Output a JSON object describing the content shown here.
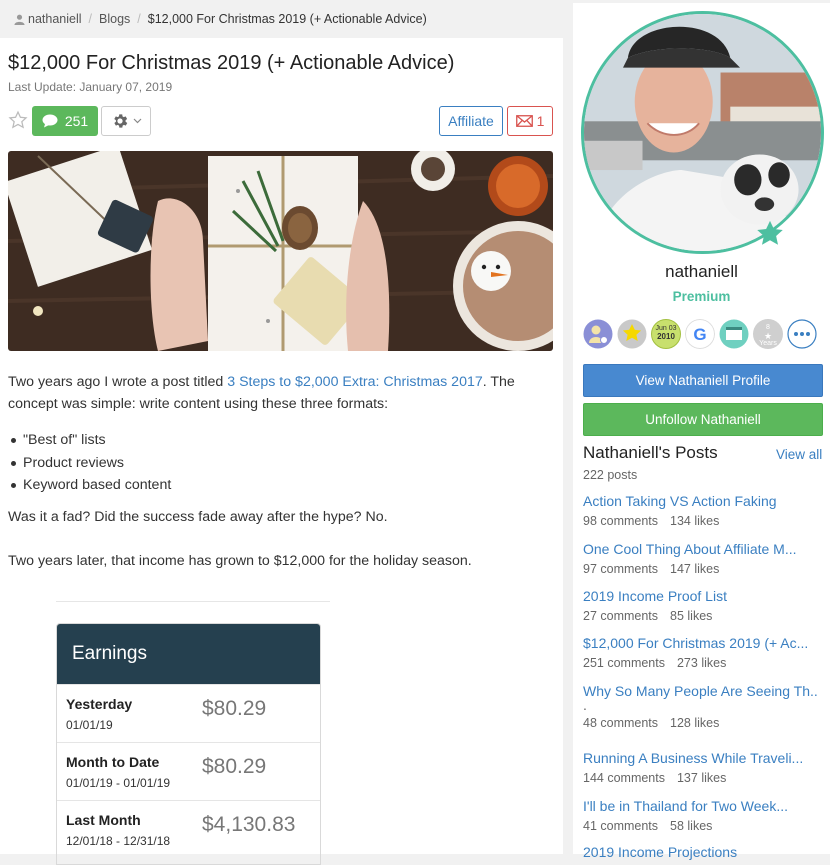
{
  "breadcrumb": {
    "items": [
      "nathaniell",
      "Blogs",
      "$12,000 For Christmas 2019 (+ Actionable Advice)"
    ],
    "separator": "/"
  },
  "article": {
    "title": "$12,000 For Christmas 2019 (+ Actionable Advice)",
    "last_update": "Last Update: January 07, 2019",
    "comment_count": "251",
    "affiliate_label": "Affiliate",
    "mail_count": "1",
    "para1_before": "Two years ago I wrote a post titled ",
    "para1_link": "3 Steps to $2,000 Extra: Christmas 2017",
    "para1_after": ". The concept was simple: write content using these three formats:",
    "bullets": [
      "\"Best of\" lists",
      "Product reviews",
      "Keyword based content"
    ],
    "para2": "Was it a fad? Did the success fade away after the hype? No.",
    "para3": "Two years later, that income has grown to $12,000 for the holiday season."
  },
  "earnings": {
    "title": "Earnings",
    "rows": [
      {
        "label": "Yesterday",
        "date": "01/01/19",
        "amount": "$80.29"
      },
      {
        "label": "Month to Date",
        "date": "01/01/19 - 01/01/19",
        "amount": "$80.29"
      },
      {
        "label": "Last Month",
        "date": "12/01/18 - 12/31/18",
        "amount": "$4,130.83"
      }
    ]
  },
  "sidebar": {
    "username": "nathaniell",
    "membership": "Premium",
    "badge_date": {
      "month": "Jun 03",
      "year": "2010"
    },
    "years_badge": {
      "num": "8",
      "label": "Years"
    },
    "view_profile_label": "View Nathaniell Profile",
    "unfollow_label": "Unfollow Nathaniell",
    "posts_title": "Nathaniell's Posts",
    "view_all_label": "View all",
    "posts_count": "222 posts",
    "posts": [
      {
        "title": "Action Taking VS Action Faking",
        "comments": "98 comments",
        "likes": "134 likes"
      },
      {
        "title": "One Cool Thing About Affiliate M...",
        "comments": "97 comments",
        "likes": "147 likes"
      },
      {
        "title": "2019 Income Proof List",
        "comments": "27 comments",
        "likes": "85 likes"
      },
      {
        "title": "$12,000 For Christmas 2019 (+ Ac...",
        "comments": "251 comments",
        "likes": "273 likes"
      },
      {
        "title": "Why So Many People Are Seeing Th..",
        "title2": ".",
        "comments": "48 comments",
        "likes": "128 likes"
      },
      {
        "title": "Running A Business While Traveli...",
        "comments": "144 comments",
        "likes": "137 likes"
      },
      {
        "title": "I'll be in Thailand for Two Week...",
        "comments": "41 comments",
        "likes": "58 likes"
      },
      {
        "title": "2019 Income Projections",
        "comments": "",
        "likes": ""
      }
    ]
  },
  "colors": {
    "accent_blue": "#3a7fc1",
    "green": "#5cb85c",
    "teal": "#4dbfa0",
    "earnings_header": "#25404f",
    "red": "#d9534f"
  }
}
